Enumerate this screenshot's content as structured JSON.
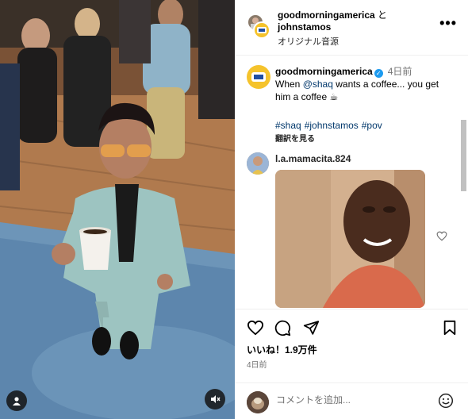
{
  "header": {
    "user1": "goodmorningamerica",
    "connector": "と",
    "user2": "johnstamos",
    "audio": "オリジナル音源",
    "more_label": "•••"
  },
  "caption": {
    "user": "goodmorningamerica",
    "time": "4日前",
    "text_before": "When ",
    "mention": "@shaq",
    "text_after": " wants a coffee... you get him a coffee ☕",
    "hashtags": [
      "#shaq",
      "#johnstamos",
      "#pov"
    ],
    "translate": "翻訳を見る"
  },
  "comment": {
    "user": "l.a.mamacita.824"
  },
  "engagement": {
    "likes": "いいね！1.9万件",
    "posted": "4日前"
  },
  "comment_box": {
    "placeholder": "コメントを追加..."
  },
  "icons": {
    "like": "heart-icon",
    "comment": "comment-icon",
    "share": "share-icon",
    "save": "bookmark-icon",
    "mute": "muted-speaker-icon",
    "tags": "user-tag-icon",
    "emoji": "emoji-icon"
  },
  "colors": {
    "verified": "#1d9bf0",
    "link": "#00376b",
    "gma_yellow": "#f5c32c"
  }
}
